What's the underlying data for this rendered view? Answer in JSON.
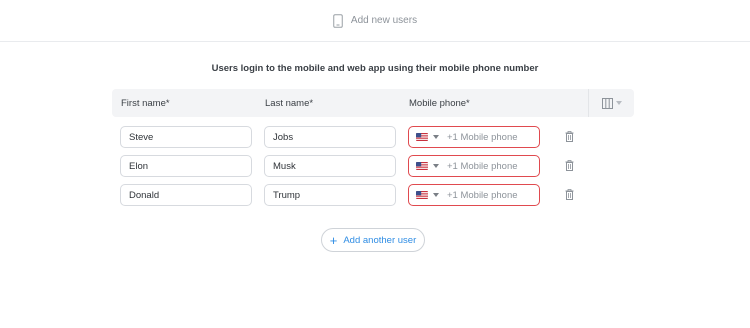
{
  "header": {
    "title": "Add new users",
    "icon": "mobile-phone-icon"
  },
  "subtitle": "Users login to the mobile and web app using their mobile phone number",
  "table": {
    "columns": [
      "First name*",
      "Last name*",
      "Mobile phone*"
    ],
    "columns_menu_icon": "columns-icon",
    "rows": [
      {
        "first_name": "Steve",
        "last_name": "Jobs",
        "country": "US",
        "phone_value": "",
        "phone_placeholder": "+1 Mobile phone"
      },
      {
        "first_name": "Elon",
        "last_name": "Musk",
        "country": "US",
        "phone_value": "",
        "phone_placeholder": "+1 Mobile phone"
      },
      {
        "first_name": "Donald",
        "last_name": "Trump",
        "country": "US",
        "phone_value": "",
        "phone_placeholder": "+1 Mobile phone"
      }
    ]
  },
  "add_button": {
    "label": "Add another user",
    "icon": "plus-icon"
  },
  "colors": {
    "accent": "#2f8de4",
    "error_border": "#e04a4f",
    "header_bg": "#f3f4f6"
  }
}
